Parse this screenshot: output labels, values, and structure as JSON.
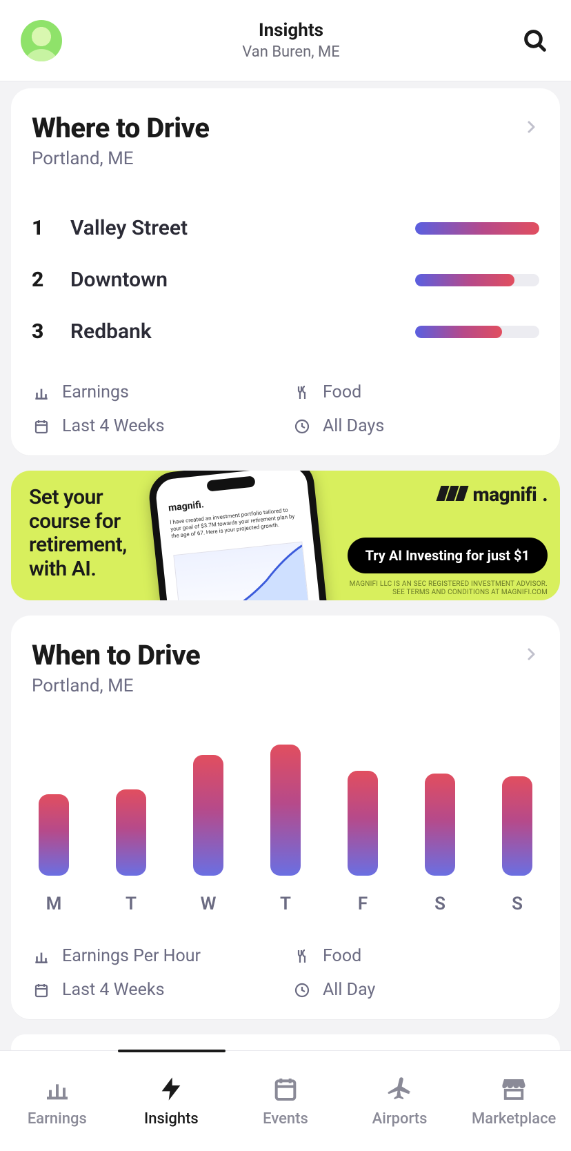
{
  "header": {
    "title": "Insights",
    "subtitle": "Van Buren, ME"
  },
  "where": {
    "title": "Where to Drive",
    "subtitle": "Portland, ME",
    "rows": [
      {
        "rank": "1",
        "name": "Valley Street",
        "pct": 100
      },
      {
        "rank": "2",
        "name": "Downtown",
        "pct": 80
      },
      {
        "rank": "3",
        "name": "Redbank",
        "pct": 70
      }
    ],
    "filters": {
      "metric": "Earnings",
      "category": "Food",
      "period": "Last 4 Weeks",
      "days": "All Days"
    }
  },
  "ad": {
    "headline_l1": "Set your",
    "headline_l2": "course for",
    "headline_l3": "retirement,",
    "headline_l4": "with AI.",
    "brand": "magnifi",
    "phone_brand": "magnifi.",
    "phone_desc": "I have created an investment portfolio tailored to your goal of $3.7M towards your retirement plan by the age of 67. Here is your projected growth.",
    "cta": "Try AI Investing for just $1",
    "disclaimer_l1": "MAGNIFI LLC IS AN SEC REGISTERED INVESTMENT ADVISOR.",
    "disclaimer_l2": "SEE TERMS AND CONDITIONS AT MAGNIFI.COM"
  },
  "when": {
    "title": "When to Drive",
    "subtitle": "Portland, ME",
    "filters": {
      "metric": "Earnings Per Hour",
      "category": "Food",
      "period": "Last 4 Weeks",
      "days": "All Day"
    }
  },
  "chart_data": {
    "type": "bar",
    "categories": [
      "M",
      "T",
      "W",
      "T",
      "F",
      "S",
      "S"
    ],
    "values": [
      62,
      66,
      92,
      100,
      80,
      78,
      76
    ],
    "title": "When to Drive — Portland, ME",
    "xlabel": "",
    "ylabel": "Earnings Per Hour (relative)",
    "note": "Values are relative bar heights read from the chart (no y-axis shown); 100 = tallest bar (Thursday)."
  },
  "tabs": [
    {
      "id": "earnings",
      "label": "Earnings"
    },
    {
      "id": "insights",
      "label": "Insights"
    },
    {
      "id": "events",
      "label": "Events"
    },
    {
      "id": "airports",
      "label": "Airports"
    },
    {
      "id": "marketplace",
      "label": "Marketplace"
    }
  ],
  "active_tab_index": 1
}
